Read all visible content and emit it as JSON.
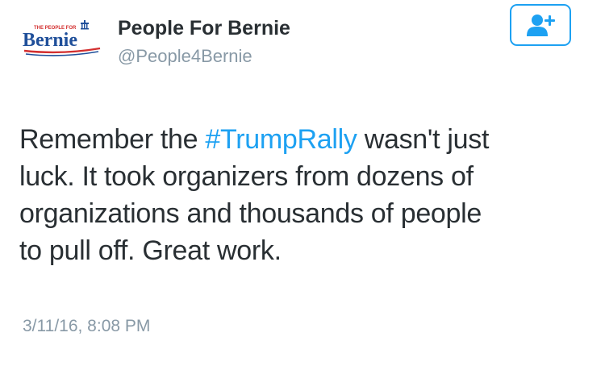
{
  "account": {
    "avatar_logo_small_text": "THE PEOPLE FOR",
    "avatar_logo_main_text": "Bernie",
    "display_name": "People For Bernie",
    "handle": "@People4Bernie"
  },
  "follow_button": {
    "icon": "add-user-icon",
    "color": "#1da1f2"
  },
  "tweet": {
    "line1_before": "Remember the ",
    "hashtag": "#TrumpRally",
    "line1_after": " wasn't just",
    "line2": "luck. It took organizers from dozens of",
    "line3": "organizations and thousands of people",
    "line4": "to pull off. Great work."
  },
  "timestamp": "3/11/16, 8:08 PM",
  "colors": {
    "text": "#292f33",
    "secondary": "#8899a6",
    "link": "#1da1f2",
    "logo_blue": "#1f4f9a",
    "logo_red": "#d32f2f"
  }
}
